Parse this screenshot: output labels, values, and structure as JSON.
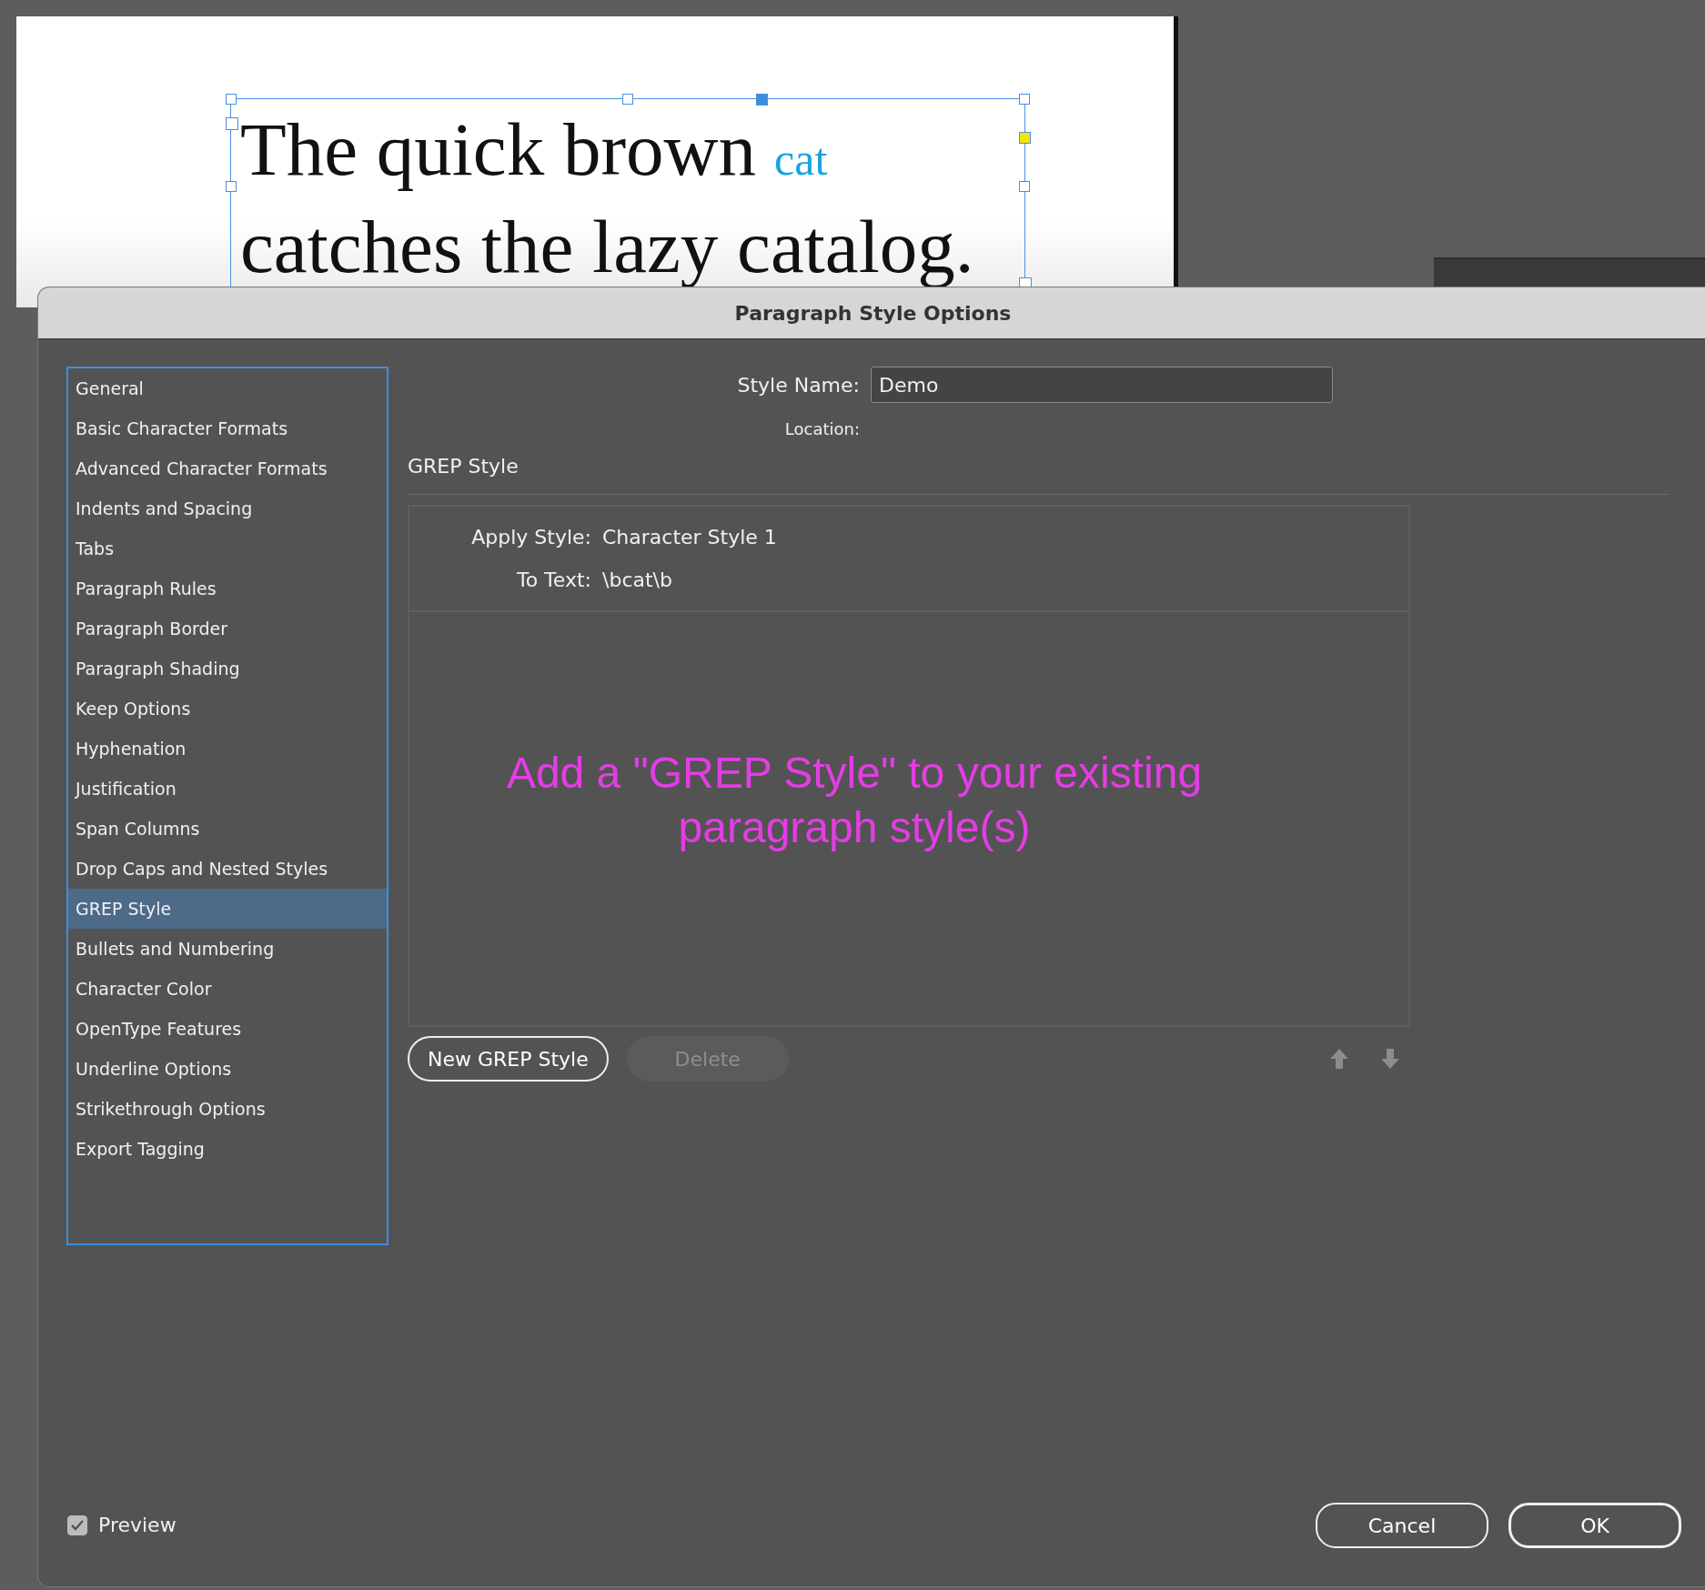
{
  "document": {
    "line_1": "The quick brown",
    "highlight": "cat",
    "line_2": "catches the lazy catalog."
  },
  "dialog": {
    "title": "Paragraph Style Options",
    "sidebar": {
      "items": [
        {
          "label": "General",
          "selected": false
        },
        {
          "label": "Basic Character Formats",
          "selected": false
        },
        {
          "label": "Advanced Character Formats",
          "selected": false
        },
        {
          "label": "Indents and Spacing",
          "selected": false
        },
        {
          "label": "Tabs",
          "selected": false
        },
        {
          "label": "Paragraph Rules",
          "selected": false
        },
        {
          "label": "Paragraph Border",
          "selected": false
        },
        {
          "label": "Paragraph Shading",
          "selected": false
        },
        {
          "label": "Keep Options",
          "selected": false
        },
        {
          "label": "Hyphenation",
          "selected": false
        },
        {
          "label": "Justification",
          "selected": false
        },
        {
          "label": "Span Columns",
          "selected": false
        },
        {
          "label": "Drop Caps and Nested Styles",
          "selected": false
        },
        {
          "label": "GREP Style",
          "selected": true
        },
        {
          "label": "Bullets and Numbering",
          "selected": false
        },
        {
          "label": "Character Color",
          "selected": false
        },
        {
          "label": "OpenType Features",
          "selected": false
        },
        {
          "label": "Underline Options",
          "selected": false
        },
        {
          "label": "Strikethrough Options",
          "selected": false
        },
        {
          "label": "Export Tagging",
          "selected": false
        }
      ]
    },
    "style_name": {
      "label": "Style Name:",
      "value": "Demo"
    },
    "location": {
      "label": "Location:"
    },
    "section_title": "GREP Style",
    "grep_rule": {
      "apply_style_label": "Apply Style:",
      "apply_style_value": "Character Style 1",
      "to_text_label": "To Text:",
      "to_text_value": "\\bcat\\b"
    },
    "annotation": {
      "line_1": "Add a \"GREP Style\" to your existing",
      "line_2": "paragraph style(s)"
    },
    "buttons": [
      {
        "label": "New GREP Style",
        "disabled": false
      },
      {
        "label": "Delete",
        "disabled": true
      }
    ],
    "preview": {
      "label": "Preview",
      "checked": true
    },
    "footer_buttons": [
      {
        "label": "Cancel",
        "default": false
      },
      {
        "label": "OK",
        "default": true
      }
    ]
  }
}
